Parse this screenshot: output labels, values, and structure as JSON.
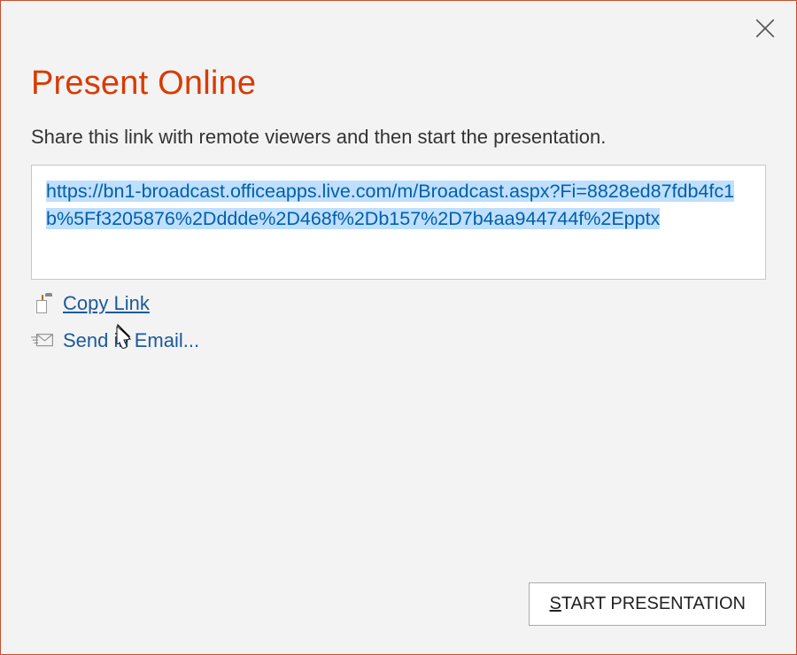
{
  "dialog": {
    "title": "Present Online",
    "instruction": "Share this link with remote viewers and then start the presentation.",
    "share_link": "https://bn1-broadcast.officeapps.live.com/m/Broadcast.aspx?Fi=8828ed87fdb4fc1b%5Ff3205876%2Dddde%2D468f%2Db157%2D7b4aa944744f%2Epptx",
    "actions": {
      "copy_link_label": "Copy Link",
      "send_email_label": "Send in Email..."
    },
    "buttons": {
      "start_prefix": "S",
      "start_suffix": "TART PRESENTATION"
    }
  }
}
